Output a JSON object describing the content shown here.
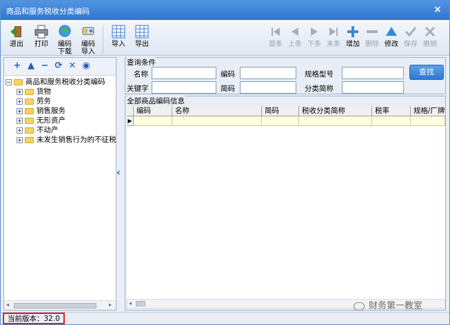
{
  "window": {
    "title": "商品和服务税收分类编码",
    "close_glyph": "×"
  },
  "toolbar": {
    "left": [
      {
        "label": "退出",
        "icon": "exit-door-icon"
      },
      {
        "label": "打印",
        "icon": "printer-icon"
      },
      {
        "label": "编码\n下载",
        "icon": "globe-download-icon"
      },
      {
        "label": "编码\n导入",
        "icon": "import-icon"
      }
    ],
    "middle": [
      {
        "label": "导入",
        "icon": "table-import-icon"
      },
      {
        "label": "导出",
        "icon": "table-export-icon"
      }
    ],
    "right": [
      {
        "label": "首条",
        "icon": "first-record-icon",
        "enabled": false
      },
      {
        "label": "上条",
        "icon": "prev-record-icon",
        "enabled": false
      },
      {
        "label": "下条",
        "icon": "next-record-icon",
        "enabled": false
      },
      {
        "label": "末条",
        "icon": "last-record-icon",
        "enabled": false
      },
      {
        "label": "增加",
        "icon": "plus-icon",
        "enabled": true
      },
      {
        "label": "删除",
        "icon": "minus-icon",
        "enabled": false
      },
      {
        "label": "修改",
        "icon": "edit-triangle-icon",
        "enabled": true
      },
      {
        "label": "保存",
        "icon": "check-icon",
        "enabled": false
      },
      {
        "label": "撤销",
        "icon": "undo-x-icon",
        "enabled": false
      }
    ]
  },
  "tree_toolbar": [
    "plus-icon",
    "up-arrow-icon",
    "minus-icon",
    "refresh-icon",
    "expand-icon",
    "target-icon"
  ],
  "tree": {
    "root": "商品和服务税收分类编码",
    "children": [
      "货物",
      "劳务",
      "销售服务",
      "无形资产",
      "不动产",
      "未发生销售行为的不征税"
    ]
  },
  "query": {
    "legend": "查询条件",
    "fields": [
      {
        "label": "名称",
        "value": ""
      },
      {
        "label": "编码",
        "value": ""
      },
      {
        "label": "规格型号",
        "value": ""
      },
      {
        "label": "关键字",
        "value": ""
      },
      {
        "label": "简码",
        "value": ""
      },
      {
        "label": "分类简称",
        "value": ""
      }
    ],
    "search_button": "查找"
  },
  "grid": {
    "legend": "全部商品编码信息",
    "columns": [
      "编码",
      "名称",
      "简码",
      "税收分类简称",
      "税率",
      "规格/厂牌"
    ],
    "row_indicator": "▶"
  },
  "status": {
    "version": "当前版本：32.0"
  },
  "watermark": {
    "text": "财务第一教室"
  },
  "colors": {
    "accent": "#2e76cf",
    "highlight_box": "#e02020",
    "grid_row": "#ffffe0"
  }
}
